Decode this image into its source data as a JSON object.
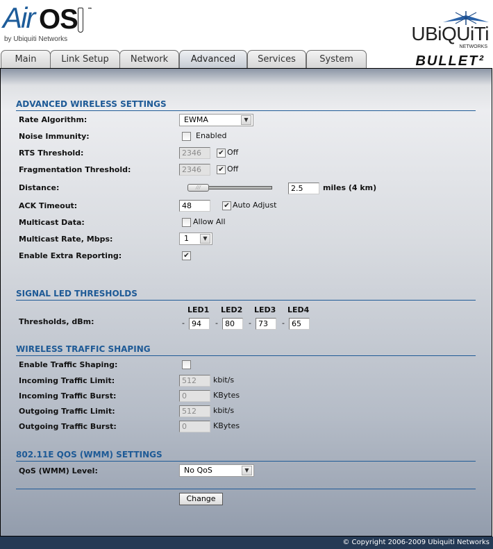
{
  "header": {
    "logo_air": "Air",
    "logo_os": "OS",
    "logo_tm": "™",
    "logo_by": "by Ubiquiti Networks",
    "brand_name": "UBiQUiTi",
    "brand_sub": "NETWORKS",
    "product": "BULLET²"
  },
  "tabs": [
    {
      "label": "Main",
      "active": false
    },
    {
      "label": "Link Setup",
      "active": false
    },
    {
      "label": "Network",
      "active": false
    },
    {
      "label": "Advanced",
      "active": true
    },
    {
      "label": "Services",
      "active": false
    },
    {
      "label": "System",
      "active": false
    }
  ],
  "advanced_wireless": {
    "title": "ADVANCED WIRELESS SETTINGS",
    "rate_algorithm": {
      "label": "Rate Algorithm:",
      "value": "EWMA"
    },
    "noise_immunity": {
      "label": "Noise Immunity:",
      "checkbox_label": "Enabled",
      "checked": false
    },
    "rts_threshold": {
      "label": "RTS Threshold:",
      "value": "2346",
      "off_label": "Off",
      "off_checked": true
    },
    "frag_threshold": {
      "label": "Fragmentation Threshold:",
      "value": "2346",
      "off_label": "Off",
      "off_checked": true
    },
    "distance": {
      "label": "Distance:",
      "value": "2.5",
      "unit_label": "miles (4 km)",
      "slider_fraction": 0.0
    },
    "ack_timeout": {
      "label": "ACK Timeout:",
      "value": "48",
      "auto_label": "Auto Adjust",
      "auto_checked": true
    },
    "multicast_data": {
      "label": "Multicast Data:",
      "checkbox_label": "Allow All",
      "checked": false
    },
    "multicast_rate": {
      "label": "Multicast Rate, Mbps:",
      "value": "1"
    },
    "extra_reporting": {
      "label": "Enable Extra Reporting:",
      "checked": true
    }
  },
  "signal_led": {
    "title": "SIGNAL LED THRESHOLDS",
    "label": "Thresholds, dBm:",
    "dash": "-",
    "leds": [
      {
        "name": "LED1",
        "value": "94"
      },
      {
        "name": "LED2",
        "value": "80"
      },
      {
        "name": "LED3",
        "value": "73"
      },
      {
        "name": "LED4",
        "value": "65"
      }
    ]
  },
  "traffic_shaping": {
    "title": "WIRELESS TRAFFIC SHAPING",
    "enable": {
      "label": "Enable Traffic Shaping:",
      "checked": false
    },
    "in_limit": {
      "label": "Incoming Traffic Limit:",
      "value": "512",
      "unit": "kbit/s"
    },
    "in_burst": {
      "label": "Incoming Traffic Burst:",
      "value": "0",
      "unit": "KBytes"
    },
    "out_limit": {
      "label": "Outgoing Traffic Limit:",
      "value": "512",
      "unit": "kbit/s"
    },
    "out_burst": {
      "label": "Outgoing Traffic Burst:",
      "value": "0",
      "unit": "KBytes"
    }
  },
  "qos": {
    "title": "802.11E QOS (WMM) SETTINGS",
    "level": {
      "label": "QoS (WMM) Level:",
      "value": "No QoS"
    }
  },
  "actions": {
    "change_label": "Change"
  },
  "footer": {
    "copyright": "© Copyright 2006-2009 Ubiquiti Networks"
  },
  "icons": {
    "check": "✔",
    "dropdown": "▼",
    "slider_grip": "///"
  }
}
